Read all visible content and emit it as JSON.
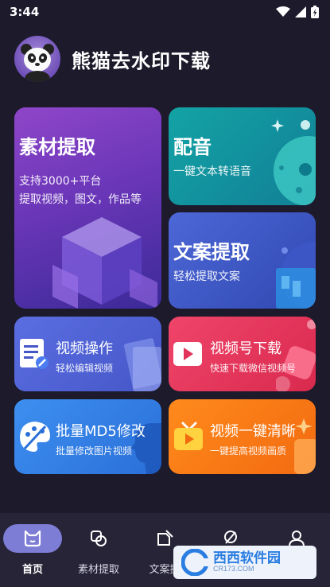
{
  "status": {
    "time": "3:44"
  },
  "header": {
    "title": "熊猫去水印下载"
  },
  "cards": [
    {
      "title": "素材提取",
      "line1": "支持3000+平台",
      "line2": "提取视频，图文，作品等"
    },
    {
      "title": "配音",
      "subtitle": "一键文本转语音"
    },
    {
      "title": "文案提取",
      "subtitle": "轻松提取文案"
    },
    {
      "title": "视频操作",
      "subtitle": "轻松编辑视频"
    },
    {
      "title": "视频号下载",
      "subtitle": "快速下载微信视频号"
    },
    {
      "title": "批量MD5修改",
      "subtitle": "批量修改图片视频"
    },
    {
      "title": "视频一键清晰",
      "subtitle": "一键提高视频画质"
    }
  ],
  "tabs": [
    {
      "label": "首页"
    },
    {
      "label": "素材提取"
    },
    {
      "label": "文案提"
    }
  ],
  "watermark": {
    "brand": "西西软件园",
    "url": "CR173.COM"
  },
  "colors": {
    "background": "#1c1a2b",
    "tab_active": "#7d7dd6"
  }
}
